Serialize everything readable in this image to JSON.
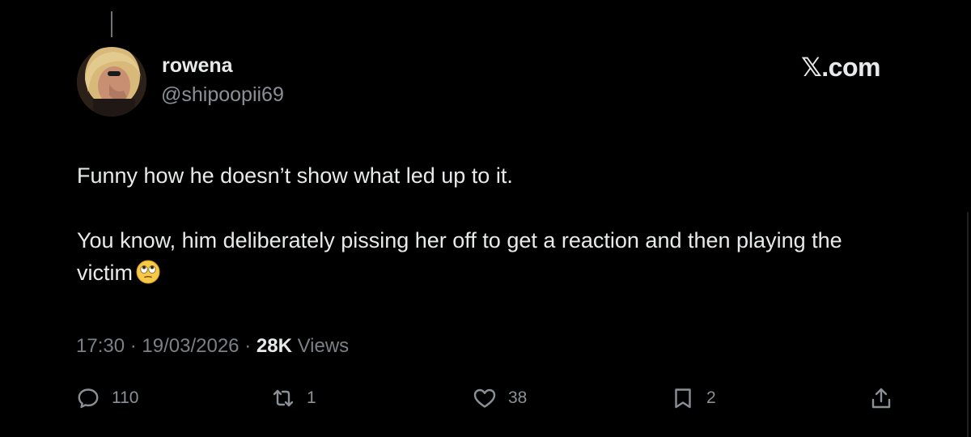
{
  "author": {
    "display_name": "rowena",
    "handle": "@shipoopii69"
  },
  "brand": "𝕏.com",
  "tweet": {
    "line1": "Funny how he doesn’t show what led up to it.",
    "line2": "You know, him deliberately pissing her off to get a reaction and then playing the victim",
    "emoji": "face-with-rolling-eyes"
  },
  "meta": {
    "time": "17:30",
    "separator": "·",
    "date": "19/03/2026",
    "views_count": "28K",
    "views_label": "Views"
  },
  "actions": {
    "replies": "110",
    "reposts": "1",
    "likes": "38",
    "bookmarks": "2"
  },
  "icons": {
    "reply": "reply-bubble-icon",
    "repost": "repost-arrows-icon",
    "like": "heart-icon",
    "bookmark": "bookmark-icon",
    "share": "share-upload-icon"
  },
  "colors": {
    "background": "#000000",
    "text_primary": "#e7e9ea",
    "text_secondary": "#8b9096"
  }
}
